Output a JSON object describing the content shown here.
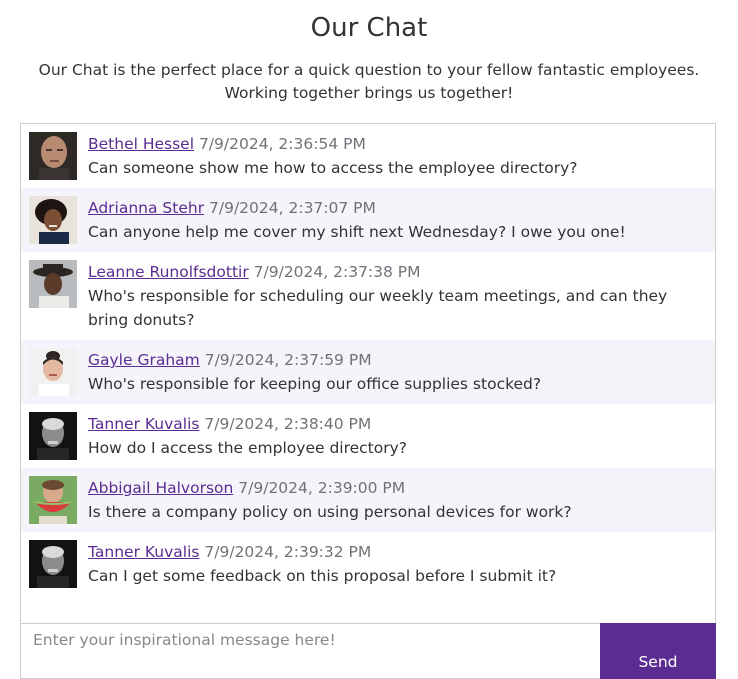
{
  "header": {
    "title": "Our Chat",
    "intro": "Our Chat is the perfect place for a quick question to your fellow fantastic employees. Working together brings us together!"
  },
  "messages": [
    {
      "author": "Bethel Hessel",
      "time": "7/9/2024, 2:36:54 PM",
      "text": "Can someone show me how to access the employee directory?",
      "avatar_icon": "person-photo-icon"
    },
    {
      "author": "Adrianna Stehr",
      "time": "7/9/2024, 2:37:07 PM",
      "text": "Can anyone help me cover my shift next Wednesday? I owe you one!",
      "avatar_icon": "person-photo-icon"
    },
    {
      "author": "Leanne Runolfsdottir",
      "time": "7/9/2024, 2:37:38 PM",
      "text": "Who's responsible for scheduling our weekly team meetings, and can they bring donuts?",
      "avatar_icon": "person-photo-icon"
    },
    {
      "author": "Gayle Graham",
      "time": "7/9/2024, 2:37:59 PM",
      "text": "Who's responsible for keeping our office supplies stocked?",
      "avatar_icon": "person-photo-icon"
    },
    {
      "author": "Tanner Kuvalis",
      "time": "7/9/2024, 2:38:40 PM",
      "text": "How do I access the employee directory?",
      "avatar_icon": "person-photo-icon"
    },
    {
      "author": "Abbigail Halvorson",
      "time": "7/9/2024, 2:39:00 PM",
      "text": "Is there a company policy on using personal devices for work?",
      "avatar_icon": "person-photo-icon"
    },
    {
      "author": "Tanner Kuvalis",
      "time": "7/9/2024, 2:39:32 PM",
      "text": "Can I get some feedback on this proposal before I submit it?",
      "avatar_icon": "person-photo-icon"
    }
  ],
  "composer": {
    "placeholder": "Enter your inspirational message here!",
    "value": "",
    "send_label": "Send"
  },
  "colors": {
    "accent": "#5b2c92",
    "alt_row": "#f5f4fa",
    "timestamp": "#6f7379"
  }
}
